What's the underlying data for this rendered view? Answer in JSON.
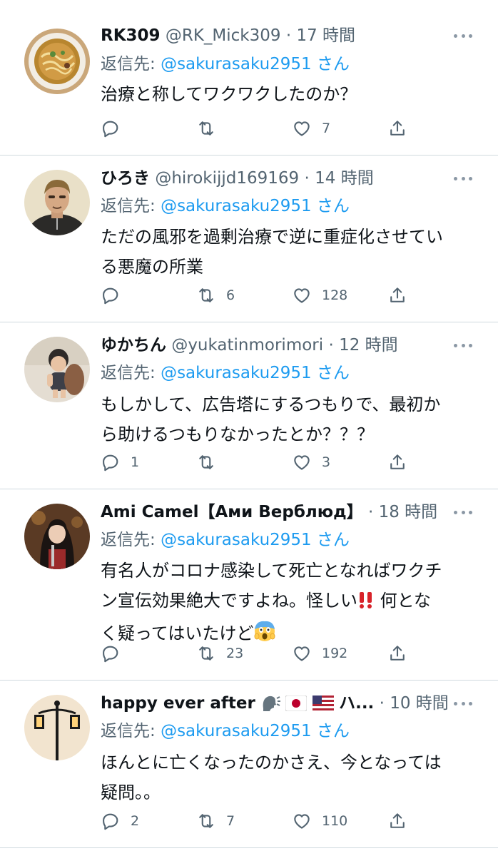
{
  "tweets": [
    {
      "name": "RK309",
      "handle": "@RK_Mick309",
      "dot": "·",
      "time": "17 時間",
      "reply_prefix": "返信先: ",
      "reply_to": "@sakurasaku2951",
      "reply_suffix": " さん",
      "text": [
        "治療と称してワクワクしたのか？"
      ],
      "replies": "",
      "retweets": "",
      "likes": "7"
    },
    {
      "name": "ひろき",
      "handle": "@hirokijjd169169",
      "dot": "·",
      "time": "14 時間",
      "reply_prefix": "返信先: ",
      "reply_to": "@sakurasaku2951",
      "reply_suffix": " さん",
      "text": [
        "ただの風邪を過剰治療で逆に重症化させてい",
        "る悪魔の所業"
      ],
      "replies": "",
      "retweets": "6",
      "likes": "128"
    },
    {
      "name": "ゆかちん",
      "handle": "@yukatinmorimori",
      "dot": "·",
      "time": "12 時間",
      "reply_prefix": "返信先: ",
      "reply_to": "@sakurasaku2951",
      "reply_suffix": " さん",
      "text": [
        "もしかして、広告塔にするつもりで、最初か",
        "ら助けるつもりなかったとか？？？"
      ],
      "replies": "1",
      "retweets": "",
      "likes": "3"
    },
    {
      "name": "Ami Camel【Ами Верблюд】",
      "handle": "",
      "dot": "·",
      "time": "18 時間",
      "reply_prefix": "返信先: ",
      "reply_to": "@sakurasaku2951",
      "reply_suffix": " さん",
      "text": [
        "有名人がコロナ感染して死亡となればワクチ",
        "ン宣伝効果絶大ですよね。怪しい",
        "‼️",
        " 何とな",
        "く疑ってはいたけど",
        "😱"
      ],
      "replies": "",
      "retweets": "23",
      "likes": "192"
    },
    {
      "name": "happy ever after",
      "name_suffix": "ハ...",
      "handle": "",
      "dot": "·",
      "time": "10 時間",
      "reply_prefix": "返信先: ",
      "reply_to": "@sakurasaku2951",
      "reply_suffix": " さん",
      "text": [
        "ほんとに亡くなったのかさえ、今となっては",
        "疑問。。"
      ],
      "replies": "2",
      "retweets": "7",
      "likes": "110"
    }
  ],
  "colors": {
    "link": "#1d9bf0",
    "secondary": "#536471",
    "primary": "#0f1419",
    "separator": "#cfd9de"
  },
  "icons": {
    "reply": "speech-bubble-icon",
    "retweet": "retweet-arrows-icon",
    "like": "heart-outline-icon",
    "share": "share-upload-icon",
    "more": "more-dots-icon"
  }
}
